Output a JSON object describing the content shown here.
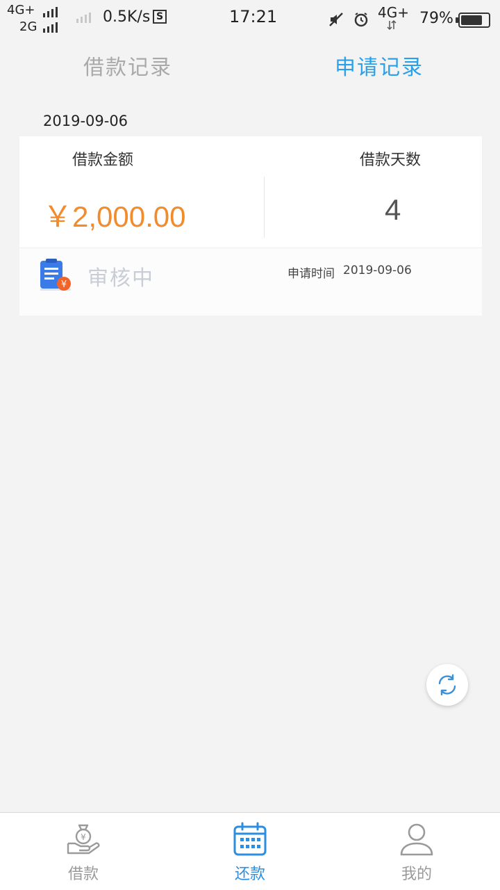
{
  "status_bar": {
    "network_top": "4G+",
    "network_bottom": "2G",
    "speed": "0.5K/s",
    "s_icon_label": "S",
    "time": "17:21",
    "network_right": "4G+",
    "battery_percent": "79%",
    "battery_level": 0.79
  },
  "tabs": [
    {
      "label": "借款记录",
      "active": false
    },
    {
      "label": "申请记录",
      "active": true
    }
  ],
  "record": {
    "date": "2019-09-06",
    "amount_label": "借款金额",
    "amount": "￥2,000.00",
    "days_label": "借款天数",
    "days": "4",
    "status": "审核中",
    "apply_time_label": "申请时间",
    "apply_time": "2019-09-06"
  },
  "bottom_nav": [
    {
      "label": "借款",
      "icon": "loan-money-bag-icon",
      "active": false
    },
    {
      "label": "还款",
      "icon": "calendar-icon",
      "active": true
    },
    {
      "label": "我的",
      "icon": "user-icon",
      "active": false
    }
  ],
  "colors": {
    "accent_blue": "#2aa0e8",
    "amount_orange": "#f28b2c",
    "nav_active": "#2b8ee0"
  }
}
